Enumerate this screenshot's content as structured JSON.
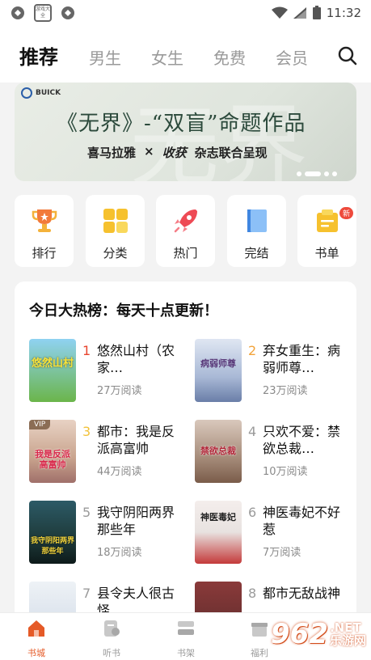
{
  "status_bar": {
    "badge_text": "游戏大全",
    "time": "11:32"
  },
  "top_tabs": [
    {
      "label": "推荐",
      "active": true
    },
    {
      "label": "男生"
    },
    {
      "label": "女生"
    },
    {
      "label": "免费"
    },
    {
      "label": "会员"
    }
  ],
  "banner": {
    "brand": "BUICK",
    "title": "《无界》-“双盲”命题作品",
    "subtitle_left": "喜马拉雅",
    "subtitle_x": "×",
    "subtitle_mid": "收获",
    "subtitle_right": "杂志联合呈现",
    "watermark": "无界"
  },
  "quick_entries": [
    {
      "label": "排行",
      "icon": "trophy-icon"
    },
    {
      "label": "分类",
      "icon": "grid-icon"
    },
    {
      "label": "热门",
      "icon": "rocket-icon"
    },
    {
      "label": "完结",
      "icon": "finished-book-icon"
    },
    {
      "label": "书单",
      "icon": "book-list-icon",
      "badge": "新"
    }
  ],
  "hot_list": {
    "heading": "今日大热榜：每天十点更新！",
    "books": [
      {
        "rank": "1",
        "title": "悠然山村（农家…",
        "reads": "27万阅读",
        "cover_text": "悠然山村",
        "cover_color": "#6bb54a",
        "rank_color": "#e8452e"
      },
      {
        "rank": "2",
        "title": "弃女重生：病弱师尊…",
        "reads": "23万阅读",
        "cover_text": "病弱师尊",
        "cover_color": "#a9b9d6",
        "rank_color": "#f2a33a"
      },
      {
        "rank": "3",
        "title": "都市：我是反派高富帅",
        "reads": "44万阅读",
        "cover_text": "我是反派高富帅",
        "cover_color": "#c9a48e",
        "rank_color": "#f2c23a",
        "vip": "VIP"
      },
      {
        "rank": "4",
        "title": "只欢不爱：禁欲总裁…",
        "reads": "10万阅读",
        "cover_text": "禁欲总裁",
        "cover_color": "#a68c7a",
        "rank_color": "#9a9a9a"
      },
      {
        "rank": "5",
        "title": "我守阴阳两界那些年",
        "reads": "18万阅读",
        "cover_text": "我守阴阳两界那些年",
        "cover_color": "#1e3a3a",
        "rank_color": "#9a9a9a"
      },
      {
        "rank": "6",
        "title": "神医毒妃不好惹",
        "reads": "7万阅读",
        "cover_text": "神医毒妃",
        "cover_color": "#e8e2e0",
        "rank_color": "#9a9a9a"
      },
      {
        "rank": "7",
        "title": "县令夫人很古怪",
        "reads": "",
        "cover_text": "",
        "cover_color": "#cfd9e6",
        "rank_color": "#9a9a9a"
      },
      {
        "rank": "8",
        "title": "都市无敌战神",
        "reads": "",
        "cover_text": "",
        "cover_color": "#5a2a2a",
        "rank_color": "#9a9a9a"
      }
    ]
  },
  "bottom_nav": [
    {
      "label": "书城",
      "icon": "home-icon",
      "active": true
    },
    {
      "label": "听书",
      "icon": "listen-icon"
    },
    {
      "label": "书架",
      "icon": "bookshelf-icon"
    },
    {
      "label": "福利",
      "icon": "gift-icon"
    }
  ],
  "watermark": {
    "number": "962",
    "net": ".NET",
    "site": "乐游网"
  },
  "colors": {
    "accent": "#e55a27",
    "rank1": "#e8452e",
    "rank2": "#f2a33a",
    "rank3": "#f2c23a"
  }
}
